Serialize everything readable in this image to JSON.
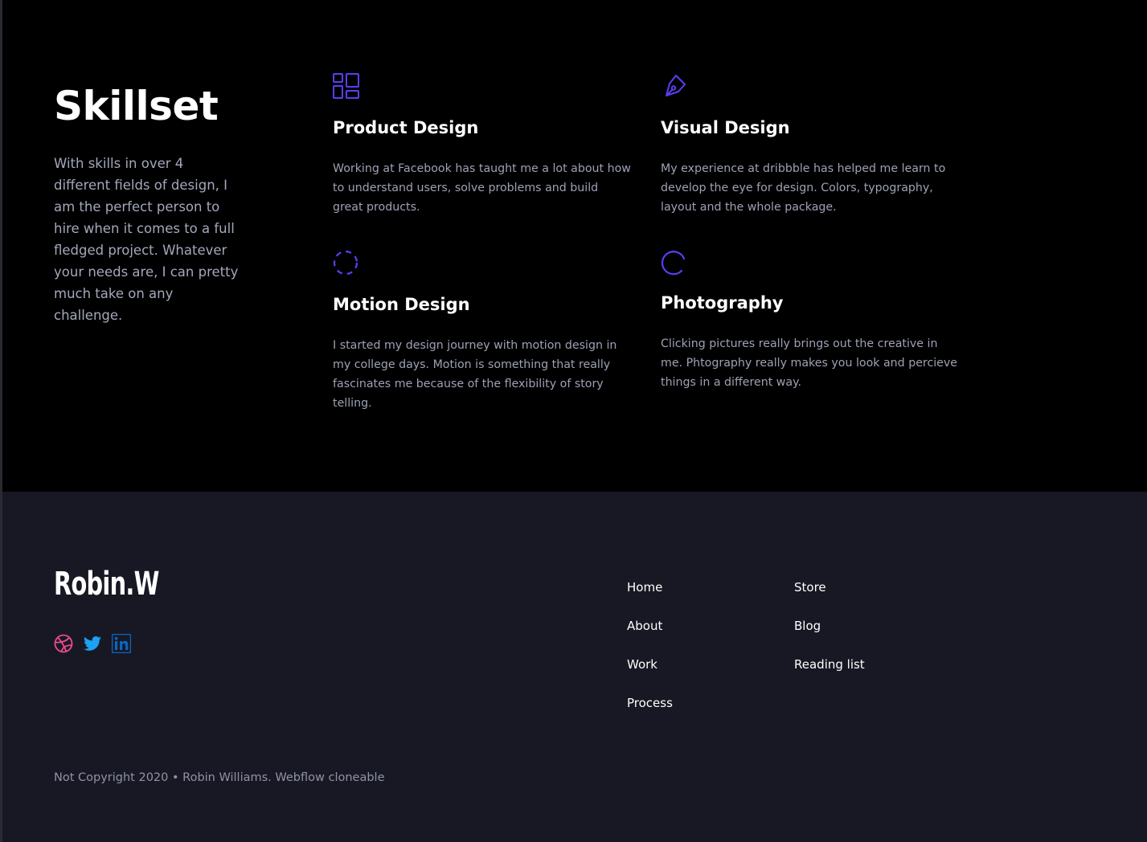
{
  "skills": {
    "title": "Skillset",
    "intro": "With skills in over 4 different fields of design, I am the perfect person to hire when it comes to a full fledged project. Whatever your needs are, I can pretty much take on any challenge.",
    "accent_color": "#5b3df5",
    "items": [
      {
        "icon": "layout-grid-icon",
        "title": "Product Design",
        "description": "Working at Facebook has taught me a lot about how to understand users, solve problems and build great products."
      },
      {
        "icon": "pen-tool-icon",
        "title": "Visual Design",
        "description": "My experience at dribbble has helped me learn to develop the eye for design. Colors, typography, layout and the whole package."
      },
      {
        "icon": "dashed-circle-icon",
        "title": "Motion Design",
        "description": "I started my design journey with motion design in my college days. Motion is something that really fascinates me because of the flexibility of story telling."
      },
      {
        "icon": "loader-circle-icon",
        "title": "Photography",
        "description": "Clicking pictures really brings out the creative in me. Phtography really makes you look and percieve things in a different way."
      }
    ]
  },
  "footer": {
    "logo": "Robin.W",
    "socials": [
      {
        "icon": "dribbble-icon",
        "color": "#ea4c89"
      },
      {
        "icon": "twitter-icon",
        "color": "#1da1f2"
      },
      {
        "icon": "linkedin-icon",
        "color": "#0a66c2"
      }
    ],
    "nav_col_1": [
      "Home",
      "About",
      "Work",
      "Process"
    ],
    "nav_col_2": [
      "Store",
      "Blog",
      "Reading list"
    ],
    "copyright": "Not Copyright 2020 • Robin Williams. Webflow cloneable"
  }
}
